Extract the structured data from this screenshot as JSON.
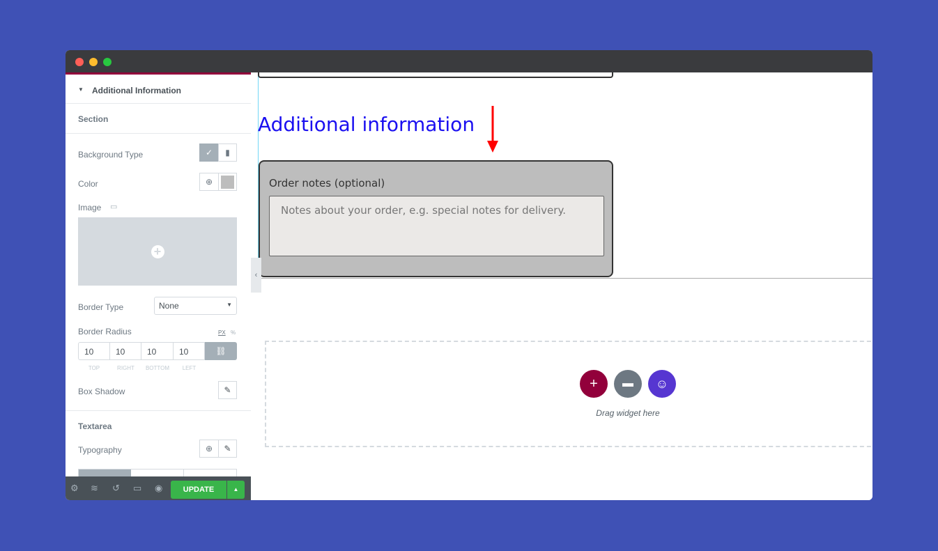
{
  "panel": {
    "section_title": "Additional Information",
    "section_label": "Section",
    "background_type": "Background Type",
    "color": "Color",
    "color_value": "#bdbdbd",
    "image": "Image",
    "border_type": "Border Type",
    "border_type_value": "None",
    "border_radius": "Border Radius",
    "unit_px": "PX",
    "unit_pct": "%",
    "radius": [
      {
        "value": "10",
        "label": "TOP"
      },
      {
        "value": "10",
        "label": "RIGHT"
      },
      {
        "value": "10",
        "label": "BOTTOM"
      },
      {
        "value": "10",
        "label": "LEFT"
      }
    ],
    "box_shadow": "Box Shadow",
    "textarea_label": "Textarea",
    "typography": "Typography"
  },
  "bottombar": {
    "update": "UPDATE"
  },
  "canvas": {
    "heading": "Additional information",
    "heading_color": "#1a0ff0",
    "field_label": "Order notes (optional)",
    "placeholder": "Notes about your order, e.g. special notes for delivery.",
    "drag_text": "Drag widget here",
    "add_color": "#92003b",
    "folder_color": "#6d7882",
    "happy_color": "#5636d1"
  }
}
